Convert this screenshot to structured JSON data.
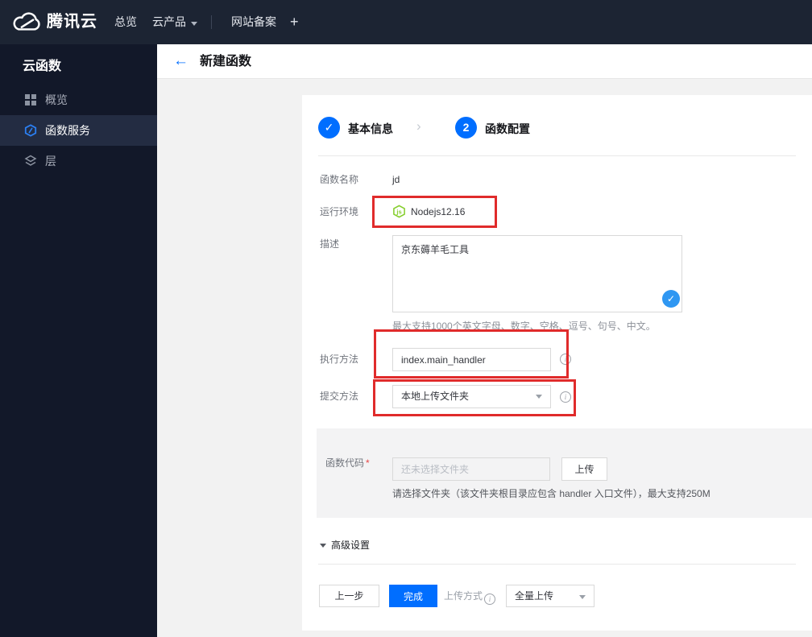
{
  "topbar": {
    "brand": "腾讯云",
    "nav": [
      {
        "label": "总览"
      },
      {
        "label": "云产品"
      },
      {
        "label": "网站备案"
      },
      {
        "label": "+"
      }
    ]
  },
  "sidebar": {
    "title": "云函数",
    "items": [
      {
        "label": "概览"
      },
      {
        "label": "函数服务"
      },
      {
        "label": "层"
      }
    ]
  },
  "header": {
    "title": "新建函数"
  },
  "steps": [
    {
      "num": "✓",
      "label": "基本信息"
    },
    {
      "num": "2",
      "label": "函数配置"
    }
  ],
  "icons": {
    "check": "✓",
    "back_arrow": "←",
    "chevron": "›",
    "info": "i"
  },
  "form": {
    "name_label": "函数名称",
    "name_value": "jd",
    "runtime_label": "运行环境",
    "runtime_value": "Nodejs12.16",
    "runtime_icon_text": "js",
    "desc_label": "描述",
    "desc_value": "京东薅羊毛工具",
    "desc_hint": "最大支持1000个英文字母、数字、空格、逗号、句号、中文。",
    "handler_label": "执行方法",
    "handler_value": "index.main_handler",
    "submit_label": "提交方法",
    "submit_value": "本地上传文件夹",
    "code_label": "函数代码",
    "required_mark": "*",
    "code_placeholder": "还未选择文件夹",
    "upload_button": "上传",
    "code_hint": "请选择文件夹（该文件夹根目录应包含 handler 入口文件），最大支持250M",
    "advanced_label": "高级设置"
  },
  "footer": {
    "prev": "上一步",
    "finish": "完成",
    "upload_mode_label": "上传方式",
    "upload_mode_value": "全量上传"
  },
  "colors": {
    "accent": "#006eff",
    "annotation": "#e02b2b",
    "node_green": "#83cd29"
  }
}
